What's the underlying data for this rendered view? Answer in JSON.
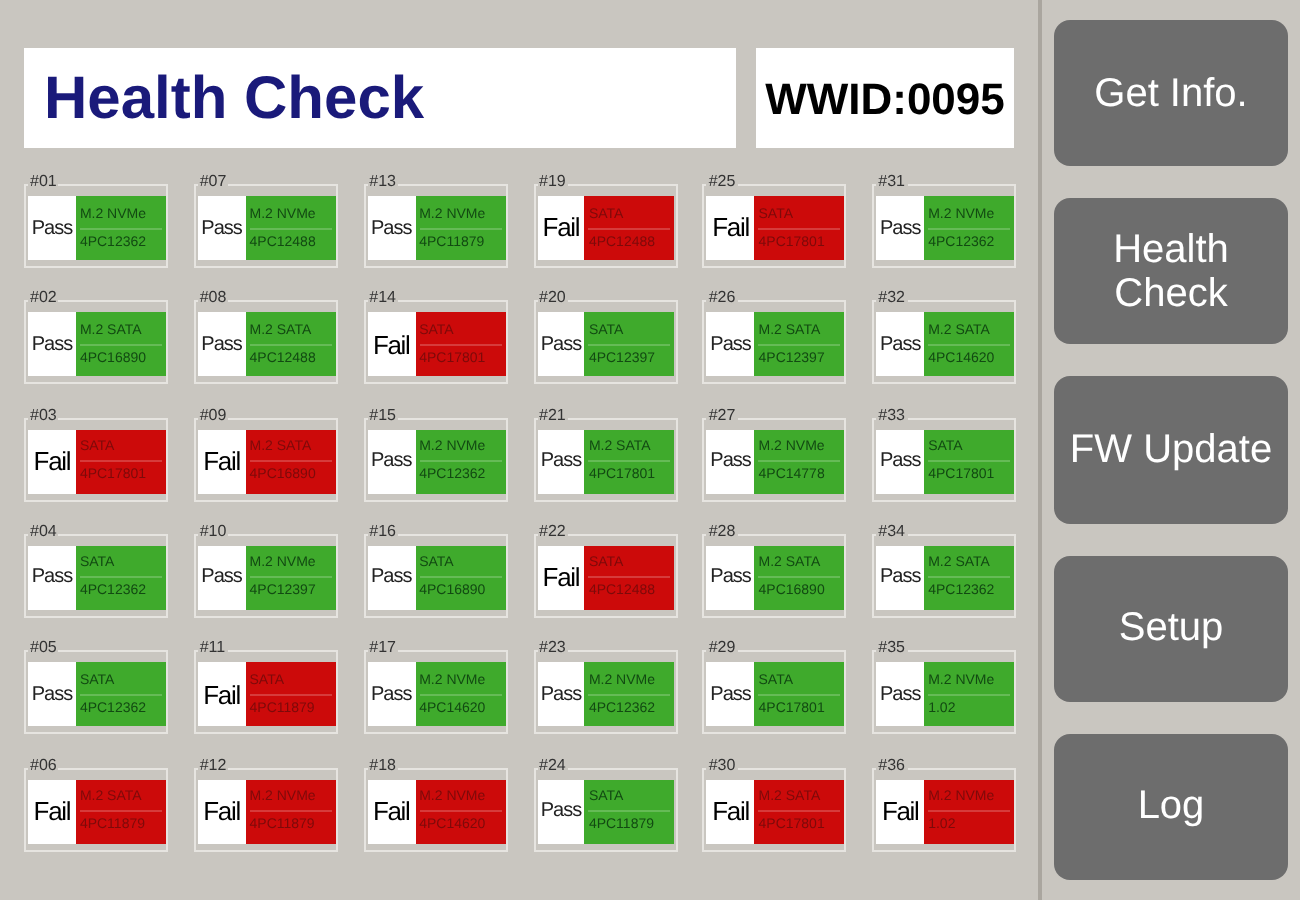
{
  "title": "Health Check",
  "wwid": "WWID:0095",
  "slots": [
    {
      "number": "#01",
      "status": "Pass",
      "failed": false,
      "type": "M.2 NVMe",
      "serial": "4PC12362"
    },
    {
      "number": "#02",
      "status": "Pass",
      "failed": false,
      "type": "M.2 SATA",
      "serial": "4PC16890"
    },
    {
      "number": "#03",
      "status": "Fail",
      "failed": true,
      "type": "SATA",
      "serial": "4PC17801"
    },
    {
      "number": "#04",
      "status": "Pass",
      "failed": false,
      "type": "SATA",
      "serial": "4PC12362"
    },
    {
      "number": "#05",
      "status": "Pass",
      "failed": false,
      "type": "SATA",
      "serial": "4PC12362"
    },
    {
      "number": "#06",
      "status": "Fail",
      "failed": true,
      "type": "M.2 SATA",
      "serial": "4PC11879"
    },
    {
      "number": "#07",
      "status": "Pass",
      "failed": false,
      "type": "M.2 NVMe",
      "serial": "4PC12488"
    },
    {
      "number": "#08",
      "status": "Pass",
      "failed": false,
      "type": "M.2 SATA",
      "serial": "4PC12488"
    },
    {
      "number": "#09",
      "status": "Fail",
      "failed": true,
      "type": "M.2 SATA",
      "serial": "4PC16890"
    },
    {
      "number": "#10",
      "status": "Pass",
      "failed": false,
      "type": "M.2 NVMe",
      "serial": "4PC12397"
    },
    {
      "number": "#11",
      "status": "Fail",
      "failed": true,
      "type": "SATA",
      "serial": "4PC11879"
    },
    {
      "number": "#12",
      "status": "Fail",
      "failed": true,
      "type": "M.2 NVMe",
      "serial": "4PC11879"
    },
    {
      "number": "#13",
      "status": "Pass",
      "failed": false,
      "type": "M.2 NVMe",
      "serial": "4PC11879"
    },
    {
      "number": "#14",
      "status": "Fail",
      "failed": true,
      "type": "SATA",
      "serial": "4PC17801"
    },
    {
      "number": "#15",
      "status": "Pass",
      "failed": false,
      "type": "M.2 NVMe",
      "serial": "4PC12362"
    },
    {
      "number": "#16",
      "status": "Pass",
      "failed": false,
      "type": "SATA",
      "serial": "4PC16890"
    },
    {
      "number": "#17",
      "status": "Pass",
      "failed": false,
      "type": "M.2 NVMe",
      "serial": "4PC14620"
    },
    {
      "number": "#18",
      "status": "Fail",
      "failed": true,
      "type": "M.2 NVMe",
      "serial": "4PC14620"
    },
    {
      "number": "#19",
      "status": "Fail",
      "failed": true,
      "type": "SATA",
      "serial": "4PC12488"
    },
    {
      "number": "#20",
      "status": "Pass",
      "failed": false,
      "type": "SATA",
      "serial": "4PC12397"
    },
    {
      "number": "#21",
      "status": "Pass",
      "failed": false,
      "type": "M.2 SATA",
      "serial": "4PC17801"
    },
    {
      "number": "#22",
      "status": "Fail",
      "failed": true,
      "type": "SATA",
      "serial": "4PC12488"
    },
    {
      "number": "#23",
      "status": "Pass",
      "failed": false,
      "type": "M.2 NVMe",
      "serial": "4PC12362"
    },
    {
      "number": "#24",
      "status": "Pass",
      "failed": false,
      "type": "SATA",
      "serial": "4PC11879"
    },
    {
      "number": "#25",
      "status": "Fail",
      "failed": true,
      "type": "SATA",
      "serial": "4PC17801"
    },
    {
      "number": "#26",
      "status": "Pass",
      "failed": false,
      "type": "M.2 SATA",
      "serial": "4PC12397"
    },
    {
      "number": "#27",
      "status": "Pass",
      "failed": false,
      "type": "M.2 NVMe",
      "serial": "4PC14778"
    },
    {
      "number": "#28",
      "status": "Pass",
      "failed": false,
      "type": "M.2 SATA",
      "serial": "4PC16890"
    },
    {
      "number": "#29",
      "status": "Pass",
      "failed": false,
      "type": "SATA",
      "serial": "4PC17801"
    },
    {
      "number": "#30",
      "status": "Fail",
      "failed": true,
      "type": "M.2 SATA",
      "serial": "4PC17801"
    },
    {
      "number": "#31",
      "status": "Pass",
      "failed": false,
      "type": "M.2 NVMe",
      "serial": "4PC12362"
    },
    {
      "number": "#32",
      "status": "Pass",
      "failed": false,
      "type": "M.2 SATA",
      "serial": "4PC14620"
    },
    {
      "number": "#33",
      "status": "Pass",
      "failed": false,
      "type": "SATA",
      "serial": "4PC17801"
    },
    {
      "number": "#34",
      "status": "Pass",
      "failed": false,
      "type": "M.2 SATA",
      "serial": "4PC12362"
    },
    {
      "number": "#35",
      "status": "Pass",
      "failed": false,
      "type": "M.2 NVMe",
      "serial": "1.02"
    },
    {
      "number": "#36",
      "status": "Fail",
      "failed": true,
      "type": "M.2 NVMe",
      "serial": "1.02"
    }
  ],
  "buttons": [
    "Get Info.",
    "Health Check",
    "FW Update",
    "Setup",
    "Log"
  ]
}
